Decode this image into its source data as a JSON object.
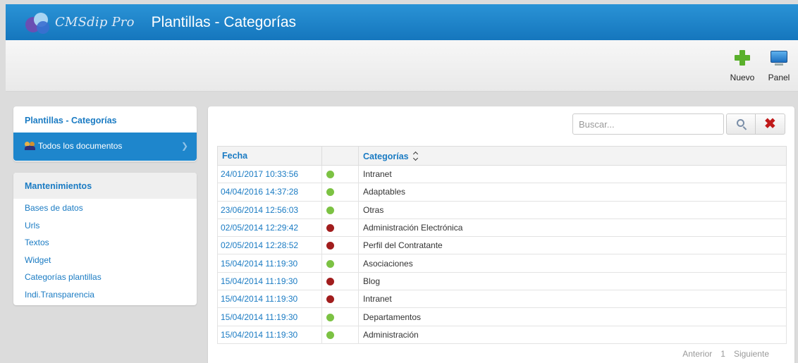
{
  "header": {
    "brand": "CMSdip Pro",
    "title": "Plantillas - Categorías"
  },
  "toolbar": {
    "new_label": "Nuevo",
    "panel_label": "Panel"
  },
  "sidebar": {
    "section1_title": "Plantillas - Categorías",
    "active_item": "Todos los documentos",
    "section2_title": "Mantenimientos",
    "links": [
      "Bases de datos",
      "Urls",
      "Textos",
      "Widget",
      "Categorías plantillas",
      "Indi.Transparencia"
    ]
  },
  "search": {
    "placeholder": "Buscar..."
  },
  "table": {
    "col_fecha": "Fecha",
    "col_categorias": "Categorías",
    "rows": [
      {
        "fecha": "24/01/2017 10:33:56",
        "status": "green",
        "categoria": "Intranet"
      },
      {
        "fecha": "04/04/2016 14:37:28",
        "status": "green",
        "categoria": "Adaptables"
      },
      {
        "fecha": "23/06/2014 12:56:03",
        "status": "green",
        "categoria": "Otras"
      },
      {
        "fecha": "02/05/2014 12:29:42",
        "status": "red",
        "categoria": "Administración Electrónica"
      },
      {
        "fecha": "02/05/2014 12:28:52",
        "status": "red",
        "categoria": "Perfil del Contratante"
      },
      {
        "fecha": "15/04/2014 11:19:30",
        "status": "green",
        "categoria": "Asociaciones"
      },
      {
        "fecha": "15/04/2014 11:19:30",
        "status": "red",
        "categoria": "Blog"
      },
      {
        "fecha": "15/04/2014 11:19:30",
        "status": "red",
        "categoria": "Intranet"
      },
      {
        "fecha": "15/04/2014 11:19:30",
        "status": "green",
        "categoria": "Departamentos"
      },
      {
        "fecha": "15/04/2014 11:19:30",
        "status": "green",
        "categoria": "Administración"
      }
    ]
  },
  "pager": {
    "prev": "Anterior",
    "page": "1",
    "next": "Siguiente"
  },
  "colors": {
    "green": "#7cc243",
    "red": "#a11d1d"
  }
}
